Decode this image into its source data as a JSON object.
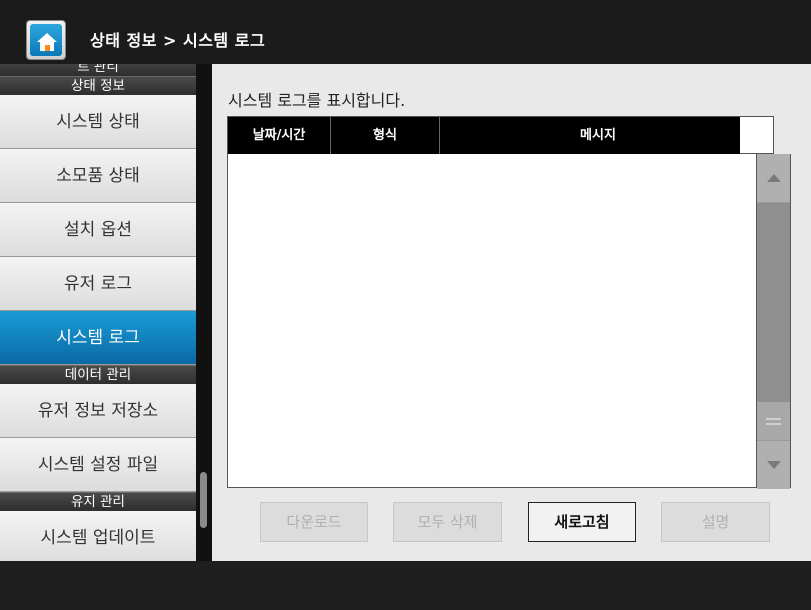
{
  "header": {
    "breadcrumb": "상태 정보 > 시스템 로그"
  },
  "sidebar": {
    "partial_top": "트 관리",
    "sections": [
      {
        "title": "상태 정보",
        "items": [
          "시스템 상태",
          "소모품 상태",
          "설치 옵션",
          "유저 로그",
          "시스템 로그"
        ]
      },
      {
        "title": "데이터 관리",
        "items": [
          "유저 정보 저장소",
          "시스템 설정 파일"
        ]
      },
      {
        "title": "유지 관리",
        "items": [
          "시스템 업데이트"
        ]
      }
    ],
    "active_item": "시스템 로그"
  },
  "main": {
    "description": "시스템 로그를 표시합니다.",
    "table": {
      "columns": [
        "날짜/시간",
        "형식",
        "메시지"
      ],
      "rows": []
    },
    "buttons": {
      "download": "다운로드",
      "delete_all": "모두 삭제",
      "refresh": "새로고침",
      "help": "설명"
    }
  },
  "colors": {
    "accent": "#0b8fd1",
    "background": "#1b1b1b",
    "panel": "#e9e9e9"
  }
}
